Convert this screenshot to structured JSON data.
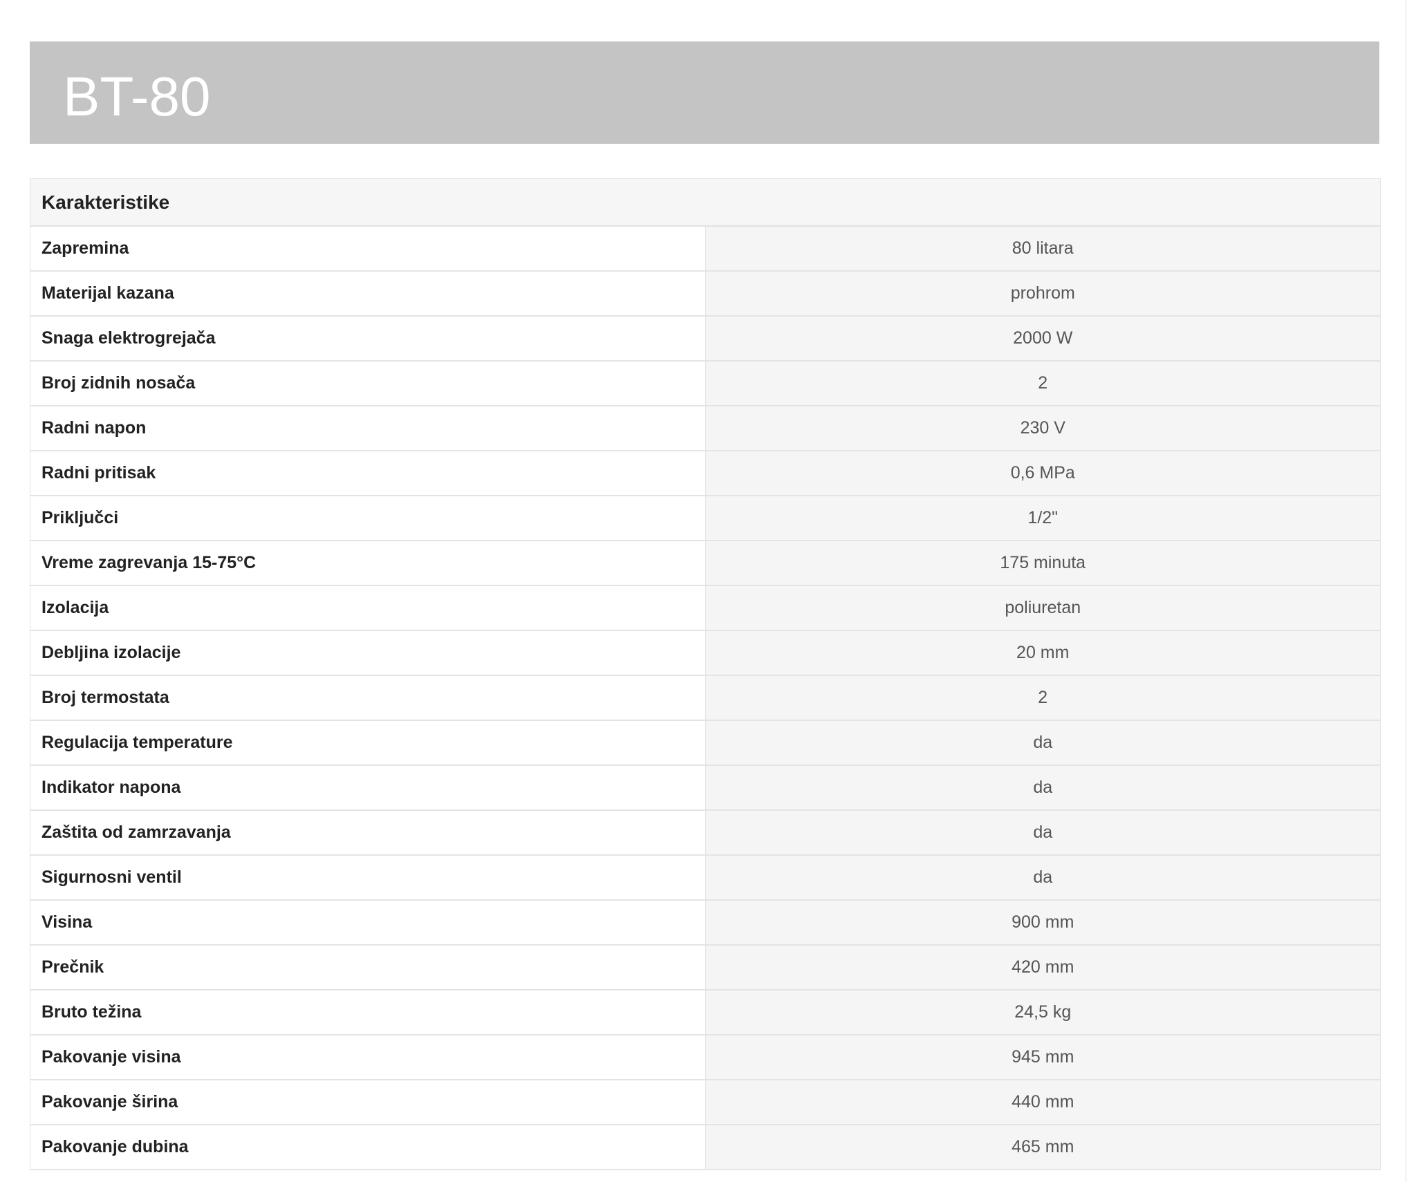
{
  "product": {
    "title": "BT-80"
  },
  "specs": {
    "header": "Karakteristike",
    "rows": [
      {
        "label": "Zapremina",
        "value": "80 litara"
      },
      {
        "label": "Materijal kazana",
        "value": "prohrom"
      },
      {
        "label": "Snaga elektrogrejača",
        "value": "2000 W"
      },
      {
        "label": "Broj zidnih nosača",
        "value": "2"
      },
      {
        "label": "Radni napon",
        "value": "230 V"
      },
      {
        "label": "Radni pritisak",
        "value": "0,6 MPa"
      },
      {
        "label": "Priključci",
        "value": "1/2\""
      },
      {
        "label": "Vreme zagrevanja 15-75°C",
        "value": "175 minuta"
      },
      {
        "label": "Izolacija",
        "value": "poliuretan"
      },
      {
        "label": "Debljina izolacije",
        "value": "20 mm"
      },
      {
        "label": "Broj termostata",
        "value": "2"
      },
      {
        "label": "Regulacija temperature",
        "value": "da"
      },
      {
        "label": "Indikator napona",
        "value": "da"
      },
      {
        "label": "Zaštita od zamrzavanja",
        "value": "da"
      },
      {
        "label": "Sigurnosni ventil",
        "value": "da"
      },
      {
        "label": "Visina",
        "value": "900 mm"
      },
      {
        "label": "Prečnik",
        "value": "420 mm"
      },
      {
        "label": "Bruto težina",
        "value": "24,5 kg"
      },
      {
        "label": "Pakovanje visina",
        "value": "945 mm"
      },
      {
        "label": "Pakovanje širina",
        "value": "440 mm"
      },
      {
        "label": "Pakovanje dubina",
        "value": "465 mm"
      }
    ]
  }
}
